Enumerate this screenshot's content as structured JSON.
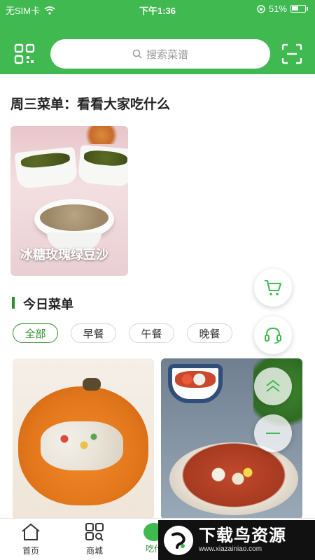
{
  "status_bar": {
    "carrier": "无SIM卡",
    "time": "下午1:36",
    "battery": "51%"
  },
  "header": {
    "search_placeholder": "搜索菜谱",
    "qr_icon": "qr-code-icon",
    "scan_icon": "scan-icon"
  },
  "featured": {
    "title": "周三菜单：看看大家吃什么",
    "card_caption": "冰糖玫瑰绿豆沙"
  },
  "today": {
    "title": "今日菜单",
    "filters": [
      {
        "label": "全部",
        "active": true
      },
      {
        "label": "早餐",
        "active": false
      },
      {
        "label": "午餐",
        "active": false
      },
      {
        "label": "晚餐",
        "active": false
      }
    ]
  },
  "floating_buttons": {
    "cart": "cart-icon",
    "service": "headset-icon",
    "to_top": "double-chevron-up-icon",
    "minimize": "minus-icon"
  },
  "bottom_nav": {
    "items": [
      {
        "label": "首页",
        "icon": "home-icon"
      },
      {
        "label": "商城",
        "icon": "grid-icon"
      },
      {
        "label": "吃什",
        "icon": "bowl-icon",
        "active": true
      }
    ]
  },
  "watermark": {
    "title": "下载鸟资源",
    "url": "www.xiazainiao.com"
  },
  "colors": {
    "primary": "#3fb950",
    "accent": "#2f8f2f"
  }
}
